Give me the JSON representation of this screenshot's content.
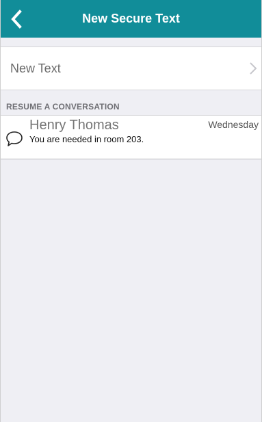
{
  "header": {
    "title": "New Secure Text",
    "back_icon": "chevron-left-icon",
    "background_color": "#118d99"
  },
  "new_text": {
    "label": "New Text",
    "chevron_icon": "chevron-right-icon"
  },
  "resume": {
    "section_title": "RESUME A CONVERSATION",
    "conversations": [
      {
        "name": "Henry Thomas",
        "preview": "You are needed in room 203.",
        "date": "Wednesday",
        "icon": "chat-bubble-icon"
      }
    ]
  }
}
